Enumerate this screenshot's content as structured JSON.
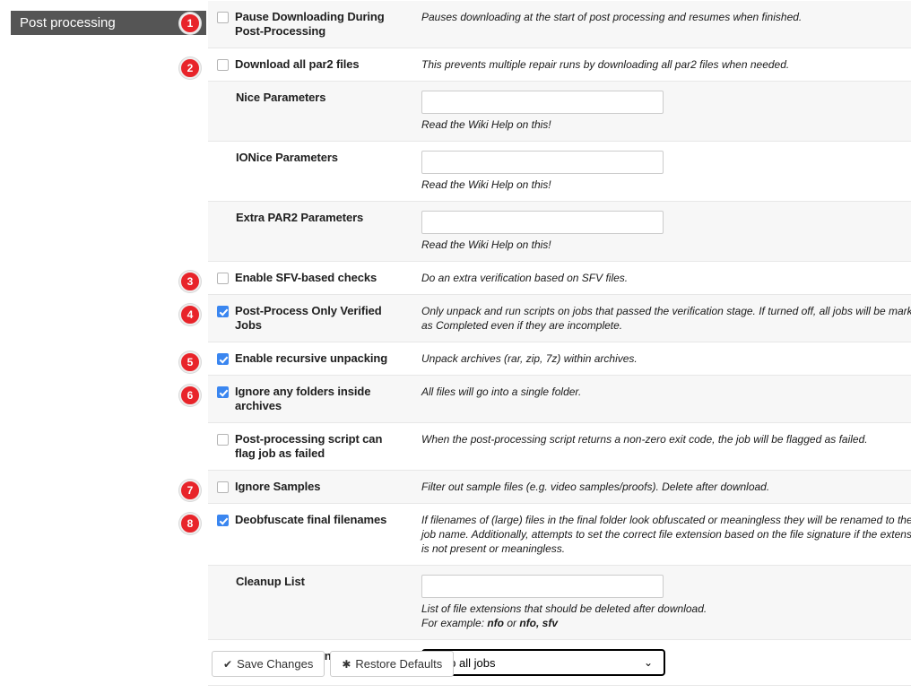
{
  "sidebar": {
    "section_title": "Post processing"
  },
  "rows": [
    {
      "kind": "checkbox",
      "label": "Pause Downloading During Post-Processing",
      "checked": false,
      "desc": "Pauses downloading at the start of post processing and resumes when finished.",
      "shaded": true,
      "badge": "1"
    },
    {
      "kind": "checkbox",
      "label": "Download all par2 files",
      "checked": false,
      "desc": "This prevents multiple repair runs by downloading all par2 files when needed.",
      "shaded": false,
      "badge": "2"
    },
    {
      "kind": "text",
      "label": "Nice Parameters",
      "value": "",
      "placeholder": "",
      "hint": "Read the Wiki Help on this!",
      "shaded": true,
      "badge": ""
    },
    {
      "kind": "text",
      "label": "IONice Parameters",
      "value": "",
      "placeholder": "",
      "hint": "Read the Wiki Help on this!",
      "shaded": false,
      "badge": ""
    },
    {
      "kind": "text",
      "label": "Extra PAR2 Parameters",
      "value": "",
      "placeholder": "",
      "hint": "Read the Wiki Help on this!",
      "shaded": true,
      "badge": ""
    },
    {
      "kind": "checkbox",
      "label": "Enable SFV-based checks",
      "checked": false,
      "desc": "Do an extra verification based on SFV files.",
      "shaded": false,
      "badge": "3"
    },
    {
      "kind": "checkbox",
      "label": "Post-Process Only Verified Jobs",
      "checked": true,
      "desc": "Only unpack and run scripts on jobs that passed the verification stage. If turned off, all jobs will be marked as Completed even if they are incomplete.",
      "shaded": true,
      "badge": "4"
    },
    {
      "kind": "checkbox",
      "label": "Enable recursive unpacking",
      "checked": true,
      "desc": "Unpack archives (rar, zip, 7z) within archives.",
      "shaded": false,
      "badge": "5"
    },
    {
      "kind": "checkbox",
      "label": "Ignore any folders inside archives",
      "checked": true,
      "desc": "All files will go into a single folder.",
      "shaded": true,
      "badge": "6"
    },
    {
      "kind": "checkbox",
      "label": "Post-processing script can flag job as failed",
      "checked": false,
      "desc": "When the post-processing script returns a non-zero exit code, the job will be flagged as failed.",
      "shaded": false,
      "badge": ""
    },
    {
      "kind": "checkbox",
      "label": "Ignore Samples",
      "checked": false,
      "desc": "Filter out sample files (e.g. video samples/proofs). Delete after download.",
      "shaded": true,
      "badge": "7"
    },
    {
      "kind": "checkbox",
      "label": "Deobfuscate final filenames",
      "checked": true,
      "desc": "If filenames of (large) files in the final folder look obfuscated or meaningless they will be renamed to the job name. Additionally, attempts to set the correct file extension based on the file signature if the extension is not present or meaningless.",
      "shaded": false,
      "badge": "8"
    },
    {
      "kind": "text",
      "label": "Cleanup List",
      "value": "",
      "placeholder": "",
      "hint": "List of file extensions that should be deleted after download.",
      "hint2_pre": "For example: ",
      "hint2_b1": "nfo",
      "hint2_mid": " or ",
      "hint2_b2": "nfo, sfv",
      "shaded": true,
      "badge": ""
    },
    {
      "kind": "select",
      "label": "History Retention",
      "value": "Keep all jobs",
      "options": [
        "Keep all jobs"
      ],
      "shaded": false,
      "badge": ""
    }
  ],
  "buttons": {
    "save": {
      "label": "Save Changes",
      "icon": "check-icon",
      "glyph": "✔"
    },
    "restore": {
      "label": "Restore Defaults",
      "icon": "asterisk-icon",
      "glyph": "✱"
    }
  },
  "colors": {
    "badge_bg": "#e8242a",
    "checkbox_checked": "#3a86f0",
    "sidebar_header_bg": "#555555",
    "row_shaded": "#f7f7f7"
  }
}
